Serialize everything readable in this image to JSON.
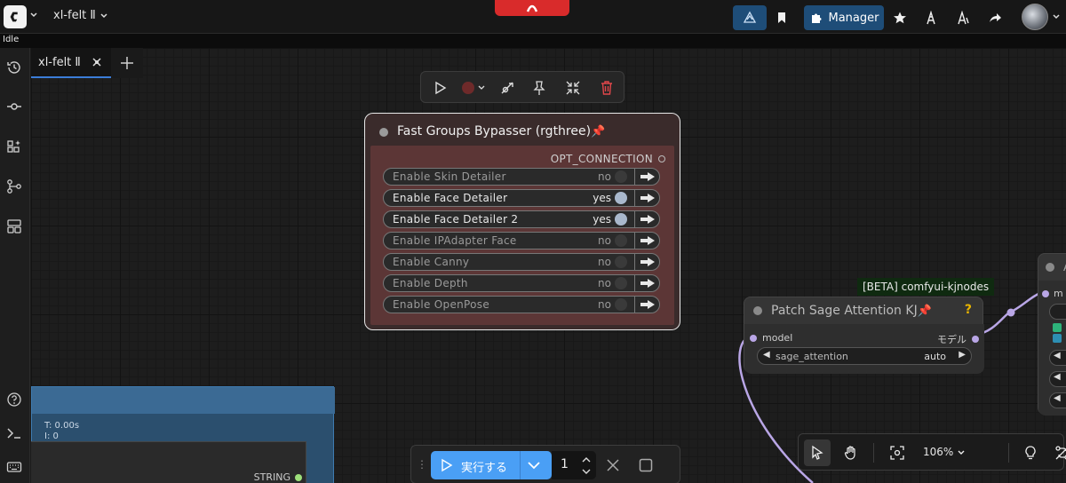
{
  "app": {
    "workflow_name": "xl-felt Ⅱ",
    "status": "Idle"
  },
  "topbar": {
    "manager_label": "Manager"
  },
  "tabs": [
    {
      "label": "xl-felt Ⅱ"
    }
  ],
  "fast_groups_bypasser": {
    "title": "Fast Groups Bypasser (rgthree)",
    "output_label": "OPT_CONNECTION",
    "toggles": [
      {
        "label": "Enable Skin Detailer",
        "value": "no"
      },
      {
        "label": "Enable Face Detailer",
        "value": "yes"
      },
      {
        "label": "Enable Face Detailer 2",
        "value": "yes"
      },
      {
        "label": "Enable IPAdapter Face",
        "value": "no"
      },
      {
        "label": "Enable Canny",
        "value": "no"
      },
      {
        "label": "Enable Depth",
        "value": "no"
      },
      {
        "label": "Enable OpenPose",
        "value": "no"
      }
    ]
  },
  "patch_sage": {
    "badge": "[BETA] comfyui-kjnodes",
    "title": "Patch Sage Attention KJ",
    "help": "?",
    "input_label": "model",
    "output_label": "モデル",
    "widget_name": "sage_attention",
    "widget_value": "auto"
  },
  "right_node": {
    "title": "A",
    "input_label": "m"
  },
  "bottom_left_node": {
    "stat_time": "T: 0.00s",
    "stat_i": "I: 0",
    "output_label": "STRING"
  },
  "runbar": {
    "run_label": "実行する",
    "count": "1"
  },
  "canvas_controls": {
    "zoom": "106%"
  },
  "colors": {
    "accent_blue": "#4a9ff5",
    "toolbar_blue": "#1e4d78",
    "bypasser_bg": "#5c3636",
    "link_lavender": "#b9a6e6",
    "status_red": "#d92b2b"
  }
}
